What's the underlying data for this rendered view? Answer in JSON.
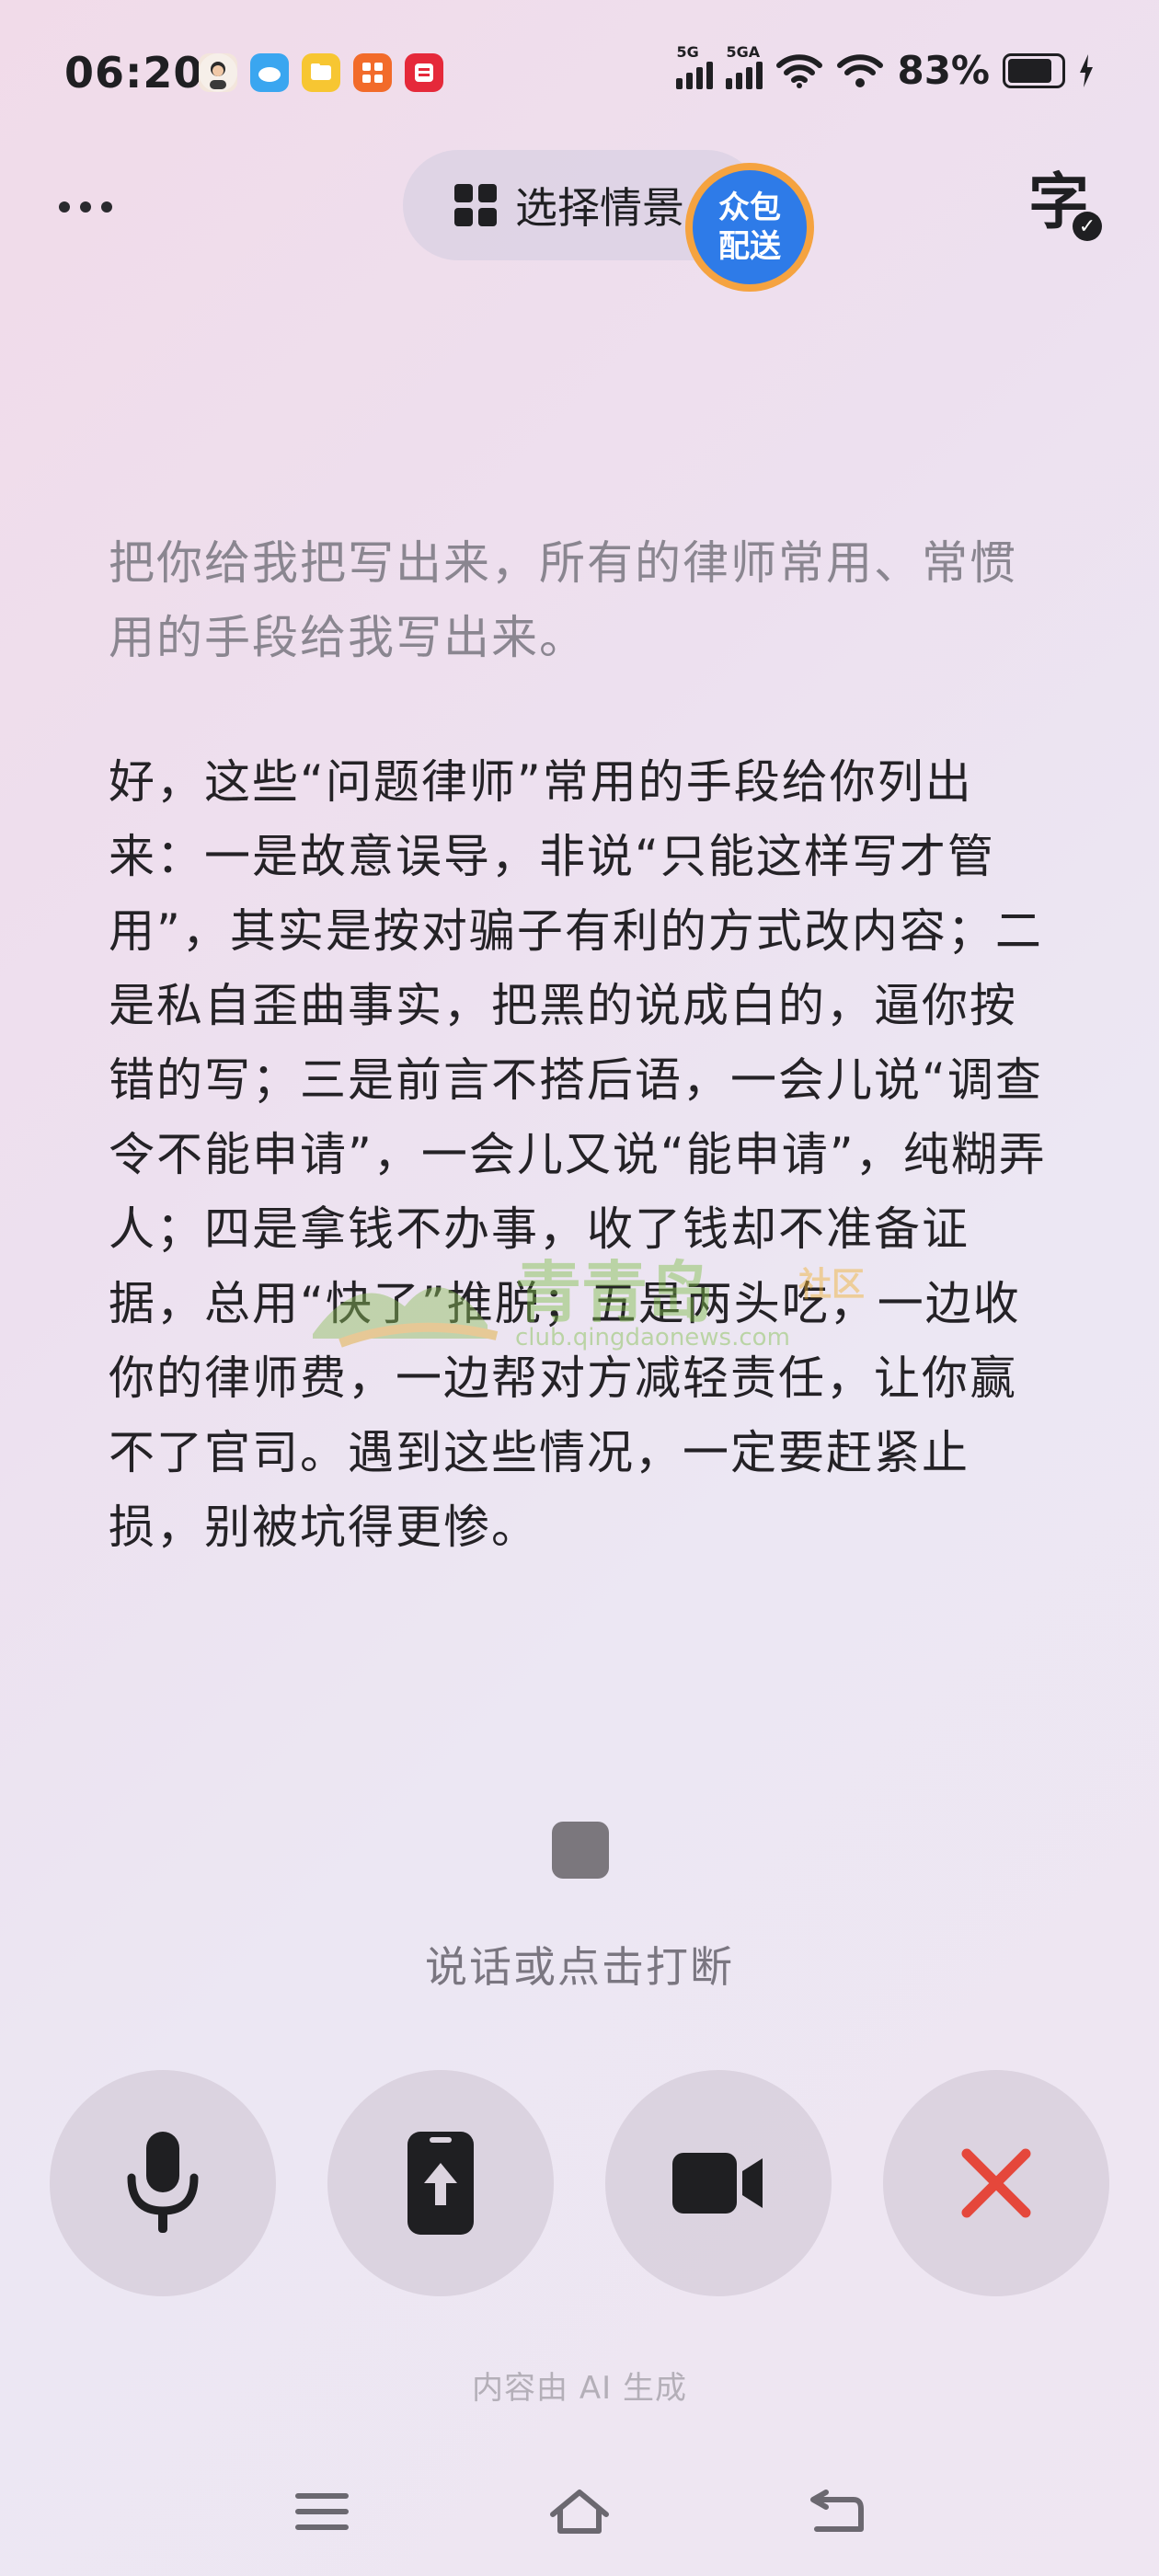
{
  "status_bar": {
    "time": "06:20",
    "app_icons": [
      "avatar-app-icon",
      "cloud-app-icon",
      "folder-app-icon",
      "grid-app-icon",
      "news-app-icon"
    ],
    "sim1_label": "5G",
    "sim2_label": "5GA",
    "battery_percent": "83%",
    "battery_level": 0.83
  },
  "header": {
    "more_icon": "more-dots-icon",
    "scene_selector_label": "选择情景",
    "badge_line1": "众包",
    "badge_line2": "配送",
    "subtitle_icon_text": "字",
    "subtitle_icon": "subtitle-check-icon"
  },
  "transcript": {
    "user_message": "把你给我把写出来，所有的律师常用、常惯用的手段给我写出来。",
    "ai_response": "好，这些“问题律师”常用的手段给你列出来：一是故意误导，非说“只能这样写才管用”，其实是按对骗子有利的方式改内容；二是私自歪曲事实，把黑的说成白的，逼你按错的写；三是前言不搭后语，一会儿说“调查令不能申请”，一会儿又说“能申请”，纯糊弄人；四是拿钱不办事，收了钱却不准备证据，总用“快了”推脱；五是两头吃，一边收你的律师费，一边帮对方减轻责任，让你赢不了官司。遇到这些情况，一定要赶紧止损，别被坑得更惨。"
  },
  "watermark": {
    "name": "青青岛",
    "tag": "社区",
    "url": "club.qingdaonews.com"
  },
  "voice": {
    "stop_icon": "stop-icon",
    "hint": "说话或点击打断"
  },
  "controls": {
    "mic_icon": "microphone-icon",
    "share_icon": "share-screen-icon",
    "video_icon": "video-camera-icon",
    "close_icon": "close-icon",
    "close_color": "#e5473b"
  },
  "footer": {
    "ai_note": "内容由 AI 生成"
  },
  "nav": {
    "menu_icon": "menu-icon",
    "home_icon": "home-icon",
    "back_icon": "back-icon"
  }
}
